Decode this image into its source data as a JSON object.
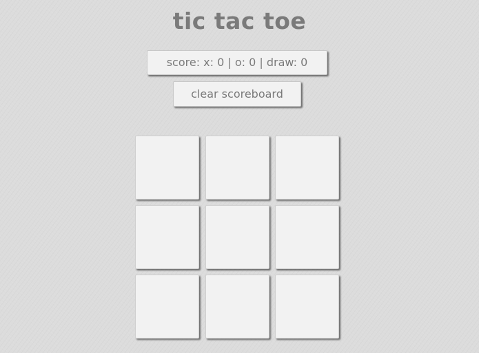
{
  "app": {
    "title": "tic tac toe"
  },
  "scoreboard": {
    "label": "score: x: 0 | o: 0 | draw: 0"
  },
  "controls": {
    "clear_label": "clear scoreboard"
  },
  "board": {
    "cells": [
      "",
      "",
      "",
      "",
      "",
      "",
      "",
      "",
      ""
    ]
  },
  "colors": {
    "background": "#dcdcdc",
    "tile": "#f2f2f2",
    "text": "#7a7a7a"
  }
}
